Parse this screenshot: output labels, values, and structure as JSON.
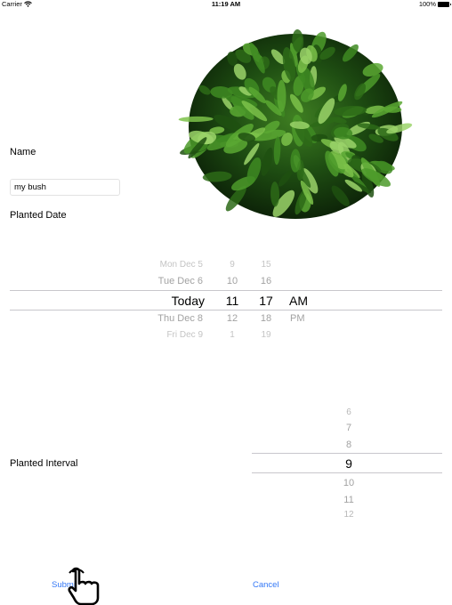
{
  "status_bar": {
    "carrier": "Carrier",
    "time": "11:19 AM",
    "battery": "100%"
  },
  "form": {
    "name_label": "Name",
    "name_value": "my bush",
    "planted_date_label": "Planted Date",
    "planted_interval_label": "Planted Interval"
  },
  "date_picker": {
    "dates": [
      "Mon Dec 5",
      "Tue Dec 6",
      "Today",
      "Thu Dec 8",
      "Fri Dec 9"
    ],
    "hours": [
      "9",
      "10",
      "11",
      "12",
      "1"
    ],
    "minutes": [
      "15",
      "16",
      "17",
      "18",
      "19"
    ],
    "ampm": [
      "AM",
      "PM"
    ],
    "selected": {
      "date": "Today",
      "hour": "11",
      "minute": "17",
      "ampm": "AM"
    }
  },
  "interval_picker": {
    "values": [
      "6",
      "7",
      "8",
      "9",
      "10",
      "11",
      "12"
    ],
    "selected": "9"
  },
  "actions": {
    "submit_label": "Submit",
    "cancel_label": "Cancel"
  },
  "icons": {
    "wifi": "wifi-icon",
    "battery": "battery-icon",
    "pointer": "hand-pointer-icon"
  }
}
